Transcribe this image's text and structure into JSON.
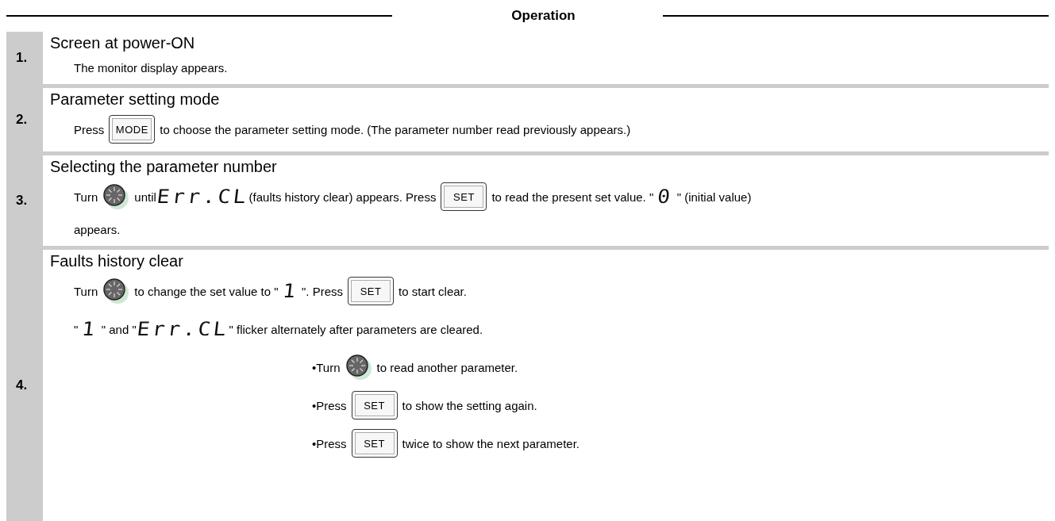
{
  "header": {
    "title": "Operation"
  },
  "steps": [
    {
      "number": "1.",
      "title": "Screen at power-ON",
      "lines": [
        {
          "kind": "plain",
          "parts": [
            {
              "kind": "text",
              "text": "The monitor display appears."
            }
          ]
        }
      ]
    },
    {
      "number": "2.",
      "title": "Parameter setting mode",
      "lines": [
        {
          "kind": "plain",
          "parts": [
            {
              "kind": "text",
              "text": "Press"
            },
            {
              "kind": "key",
              "text": "MODE"
            },
            {
              "kind": "text",
              "text": "to choose the parameter setting mode. (The parameter number read previously appears.)"
            }
          ]
        }
      ]
    },
    {
      "number": "3.",
      "title": "Selecting the parameter number",
      "lines": [
        {
          "kind": "plain",
          "parts": [
            {
              "kind": "text",
              "text": "Turn"
            },
            {
              "kind": "dial"
            },
            {
              "kind": "text",
              "text": "until"
            },
            {
              "kind": "segment",
              "text": "Err.CL"
            },
            {
              "kind": "text",
              "text": "(faults history clear) appears. Press"
            },
            {
              "kind": "key",
              "text": "SET"
            },
            {
              "kind": "text",
              "text": "to read the present set value. \""
            },
            {
              "kind": "segment",
              "text": "0"
            },
            {
              "kind": "text",
              "text": "\" (initial value)"
            }
          ]
        },
        {
          "kind": "plain",
          "parts": [
            {
              "kind": "text",
              "text": "appears."
            }
          ]
        }
      ]
    },
    {
      "number": "4.",
      "title": "Faults history clear",
      "lines": [
        {
          "kind": "plain",
          "parts": [
            {
              "kind": "text",
              "text": "Turn"
            },
            {
              "kind": "dial"
            },
            {
              "kind": "text",
              "text": "to change the set value to \""
            },
            {
              "kind": "segment",
              "text": "1"
            },
            {
              "kind": "text",
              "text": "\". Press"
            },
            {
              "kind": "key",
              "text": "SET"
            },
            {
              "kind": "text",
              "text": "to start clear."
            }
          ]
        },
        {
          "kind": "plain",
          "parts": [
            {
              "kind": "text",
              "text": "\""
            },
            {
              "kind": "segment",
              "text": "1"
            },
            {
              "kind": "text",
              "text": "\" and \""
            },
            {
              "kind": "segment",
              "text": "Err.CL"
            },
            {
              "kind": "text",
              "text": "\" flicker alternately after parameters are cleared."
            }
          ]
        },
        {
          "kind": "bullet",
          "parts": [
            {
              "kind": "text",
              "text": "•Turn"
            },
            {
              "kind": "dial"
            },
            {
              "kind": "text",
              "text": "to read another parameter."
            }
          ]
        },
        {
          "kind": "bullet",
          "parts": [
            {
              "kind": "text",
              "text": "•Press"
            },
            {
              "kind": "key",
              "text": "SET"
            },
            {
              "kind": "text",
              "text": "to show the setting again."
            }
          ]
        },
        {
          "kind": "bullet",
          "parts": [
            {
              "kind": "text",
              "text": "•Press"
            },
            {
              "kind": "key",
              "text": "SET"
            },
            {
              "kind": "text",
              "text": "twice to show the next parameter."
            }
          ]
        }
      ]
    }
  ]
}
